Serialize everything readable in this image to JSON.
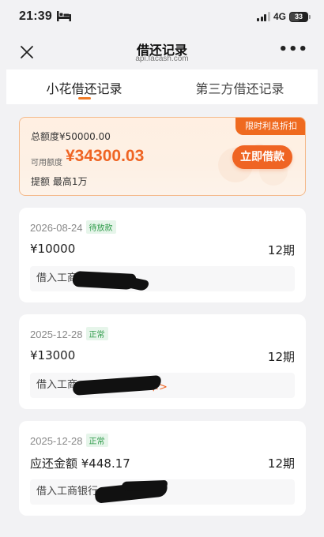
{
  "status_bar": {
    "time": "21:39",
    "network": "4G",
    "battery": "33"
  },
  "nav": {
    "title": "借还记录",
    "subtitle": "api.facash.com",
    "more": "•••"
  },
  "tabs": [
    {
      "label": "小花借还记录",
      "active": true
    },
    {
      "label": "第三方借还记录",
      "active": false
    }
  ],
  "credit": {
    "promo": "限时利息折扣",
    "total": "总额度¥50000.00",
    "available_label": "可用额度",
    "available_value": "¥34300.03",
    "borrow_button": "立即借款",
    "raise_text": "提额 最高1万"
  },
  "records": [
    {
      "date": "2026-08-24",
      "status": "待放款",
      "amount": "¥10000",
      "term": "12期",
      "bank": "借入工商"
    },
    {
      "date": "2025-12-28",
      "status": "正常",
      "amount": "¥13000",
      "term": "12期",
      "bank": "借入工商",
      "link": "卡>"
    },
    {
      "date": "2025-12-28",
      "status": "正常",
      "amount": "应还金额 ¥448.17",
      "term": "12期",
      "bank": "借入工商银行"
    }
  ],
  "colors": {
    "accent": "#ef6423",
    "status_green": "#2f9b4a",
    "page_bg": "#f2f2f4"
  }
}
